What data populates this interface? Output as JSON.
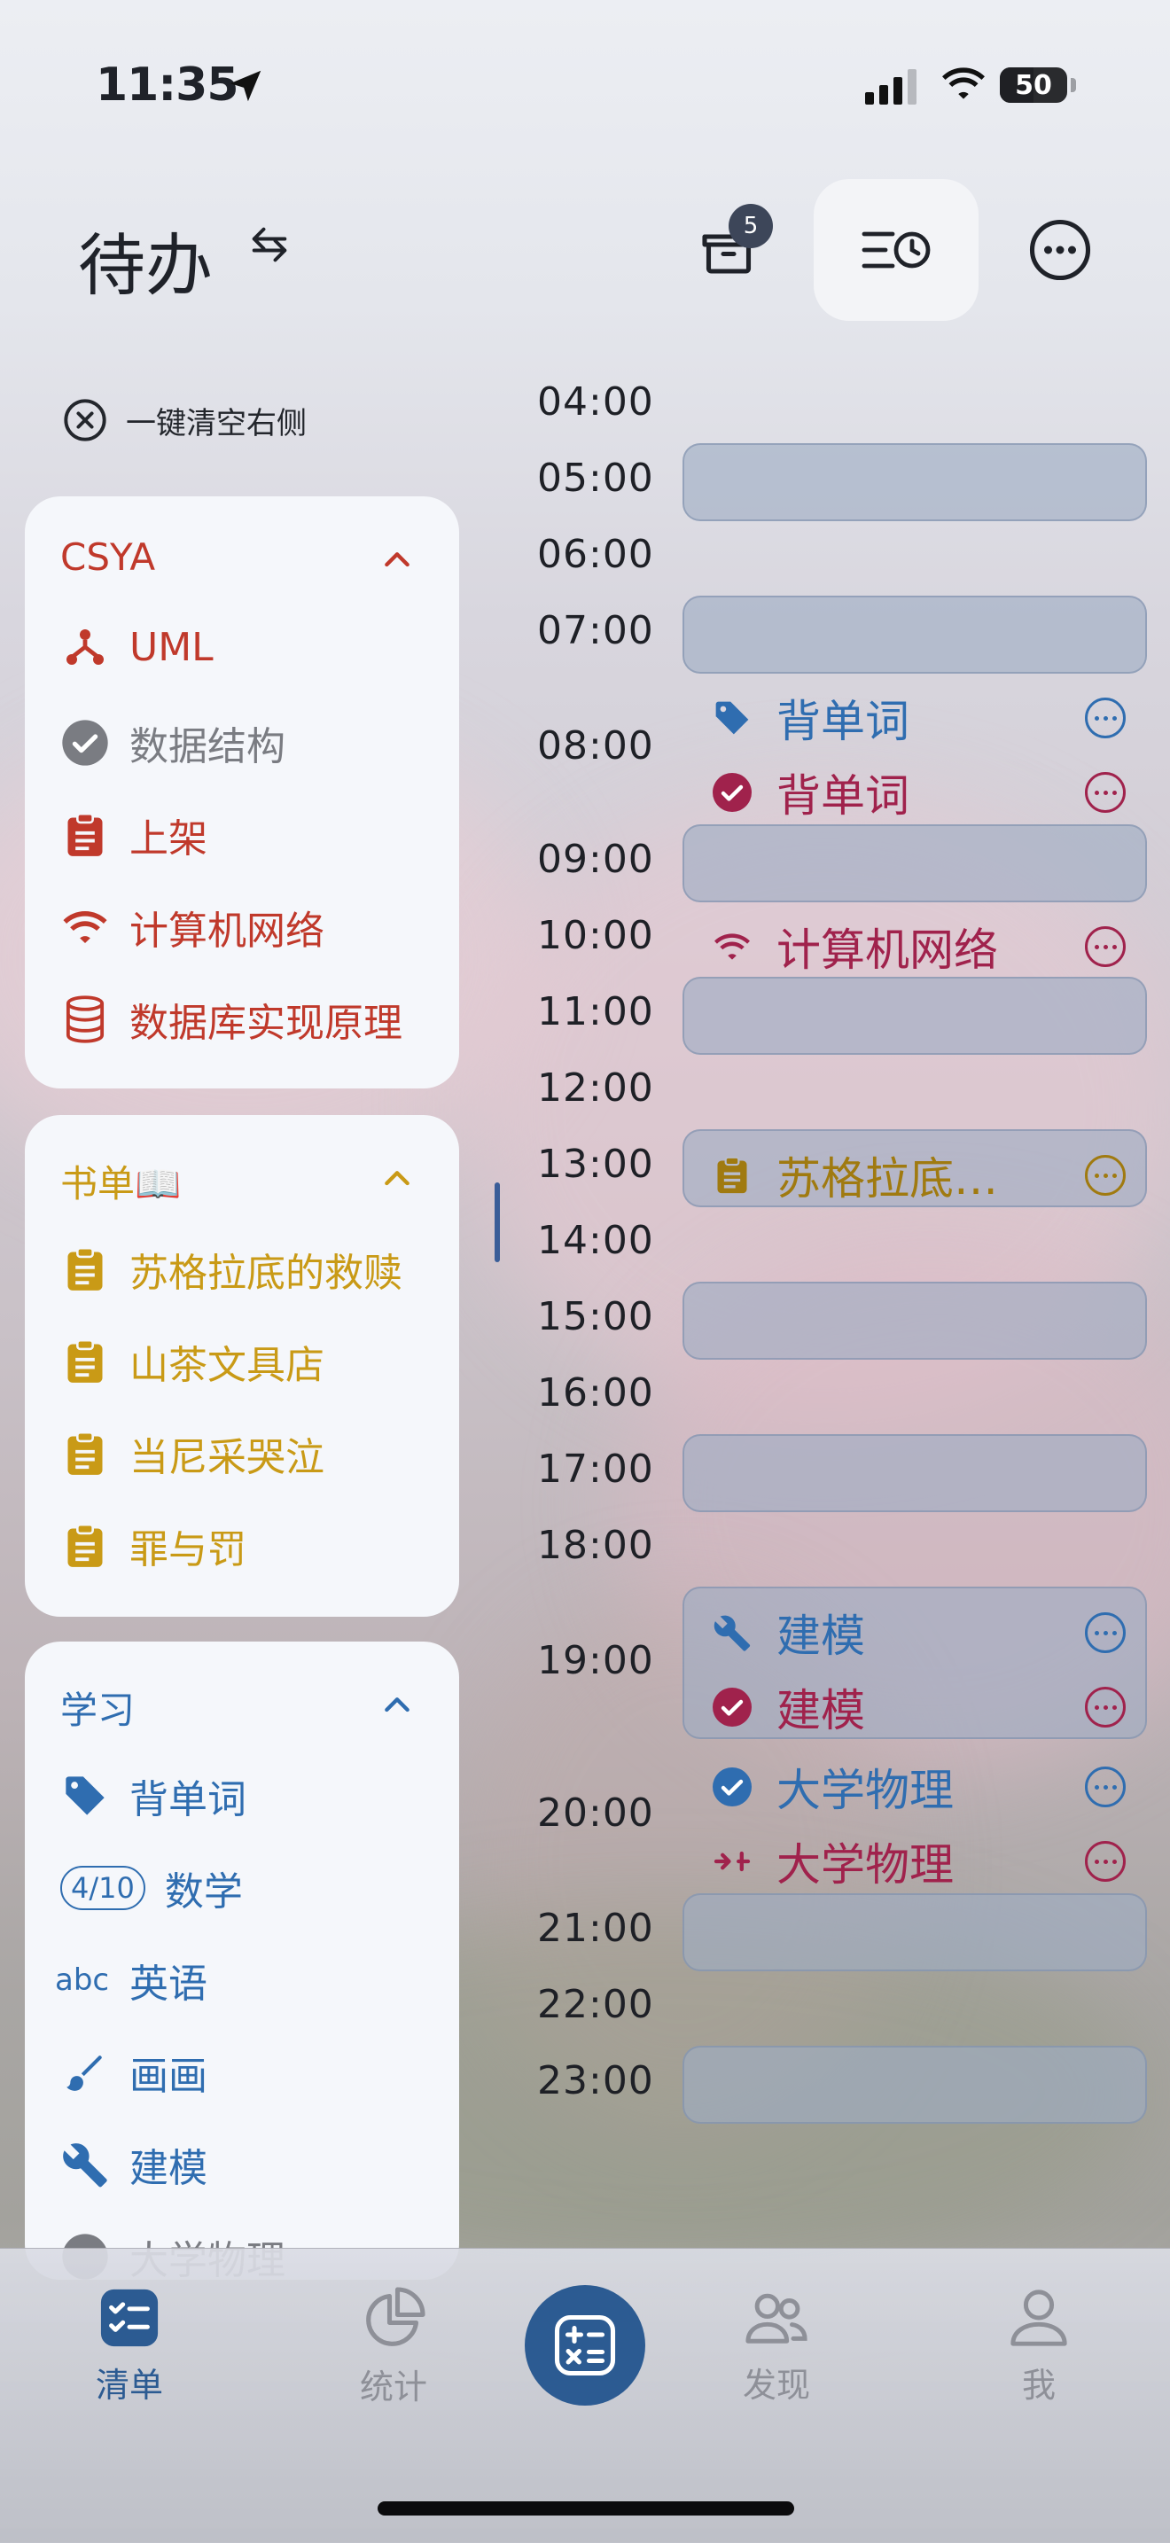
{
  "status_bar": {
    "time": "11:35",
    "battery": "50"
  },
  "header": {
    "title": "待办",
    "inbox_badge": "5"
  },
  "clear_right": "一键清空右侧",
  "colors": {
    "red": "#c0392b",
    "grey": "#7a7c82",
    "gold": "#c99a16",
    "blue": "#2f6db0",
    "crimson": "#a0224c",
    "navy": "#2c5b92",
    "slot": "#9eacc4"
  },
  "groups": [
    {
      "title": "CSYA",
      "items": [
        {
          "label": "UML",
          "icon": "hierarchy-icon"
        },
        {
          "label": "数据结构",
          "icon": "check-circle-icon"
        },
        {
          "label": "上架",
          "icon": "clipboard-icon"
        },
        {
          "label": "计算机网络",
          "icon": "wifi-icon"
        },
        {
          "label": "数据库实现原理",
          "icon": "database-icon"
        }
      ]
    },
    {
      "title": "书单📖",
      "items": [
        {
          "label": "苏格拉底的救赎",
          "icon": "clipboard-icon"
        },
        {
          "label": "山茶文具店",
          "icon": "clipboard-icon"
        },
        {
          "label": "当尼采哭泣",
          "icon": "clipboard-icon"
        },
        {
          "label": "罪与罚",
          "icon": "clipboard-icon"
        }
      ]
    },
    {
      "title": "学习",
      "items": [
        {
          "label": "背单词",
          "icon": "tag-icon"
        },
        {
          "label": "数学",
          "icon": "progress-pill",
          "badge": "4/10"
        },
        {
          "label": "英语",
          "icon": "abc-icon",
          "badge": "abc"
        },
        {
          "label": "画画",
          "icon": "brush-icon"
        },
        {
          "label": "建模",
          "icon": "wrench-icon"
        },
        {
          "label": "大学物理",
          "icon": "check-circle-icon"
        }
      ]
    }
  ],
  "timeline": {
    "hours": [
      "04:00",
      "05:00",
      "06:00",
      "07:00",
      "08:00",
      "09:00",
      "10:00",
      "11:00",
      "12:00",
      "13:00",
      "14:00",
      "15:00",
      "16:00",
      "17:00",
      "18:00",
      "19:00",
      "20:00",
      "21:00",
      "22:00",
      "23:00"
    ],
    "events": [
      {
        "label": "背单词",
        "icon": "tag-icon",
        "color": "#2f6db0"
      },
      {
        "label": "背单词",
        "icon": "check-circle-icon",
        "color": "#a0224c"
      },
      {
        "label": "计算机网络",
        "icon": "wifi-icon",
        "color": "#a0224c"
      },
      {
        "label": "苏格拉底…",
        "icon": "clipboard-icon",
        "color": "#a07a10"
      },
      {
        "label": "建模",
        "icon": "wrench-icon",
        "color": "#2f6db0"
      },
      {
        "label": "建模",
        "icon": "check-circle-icon",
        "color": "#a0224c"
      },
      {
        "label": "大学物理",
        "icon": "check-circle-icon",
        "color": "#2f6db0"
      },
      {
        "label": "大学物理",
        "icon": "merge-icon",
        "color": "#a0224c"
      }
    ]
  },
  "tabs": [
    {
      "label": "清单",
      "icon": "checklist-icon"
    },
    {
      "label": "统计",
      "icon": "pie-chart-icon"
    },
    {
      "label": "",
      "icon": "calculator-icon"
    },
    {
      "label": "发现",
      "icon": "people-icon"
    },
    {
      "label": "我",
      "icon": "person-icon"
    }
  ]
}
